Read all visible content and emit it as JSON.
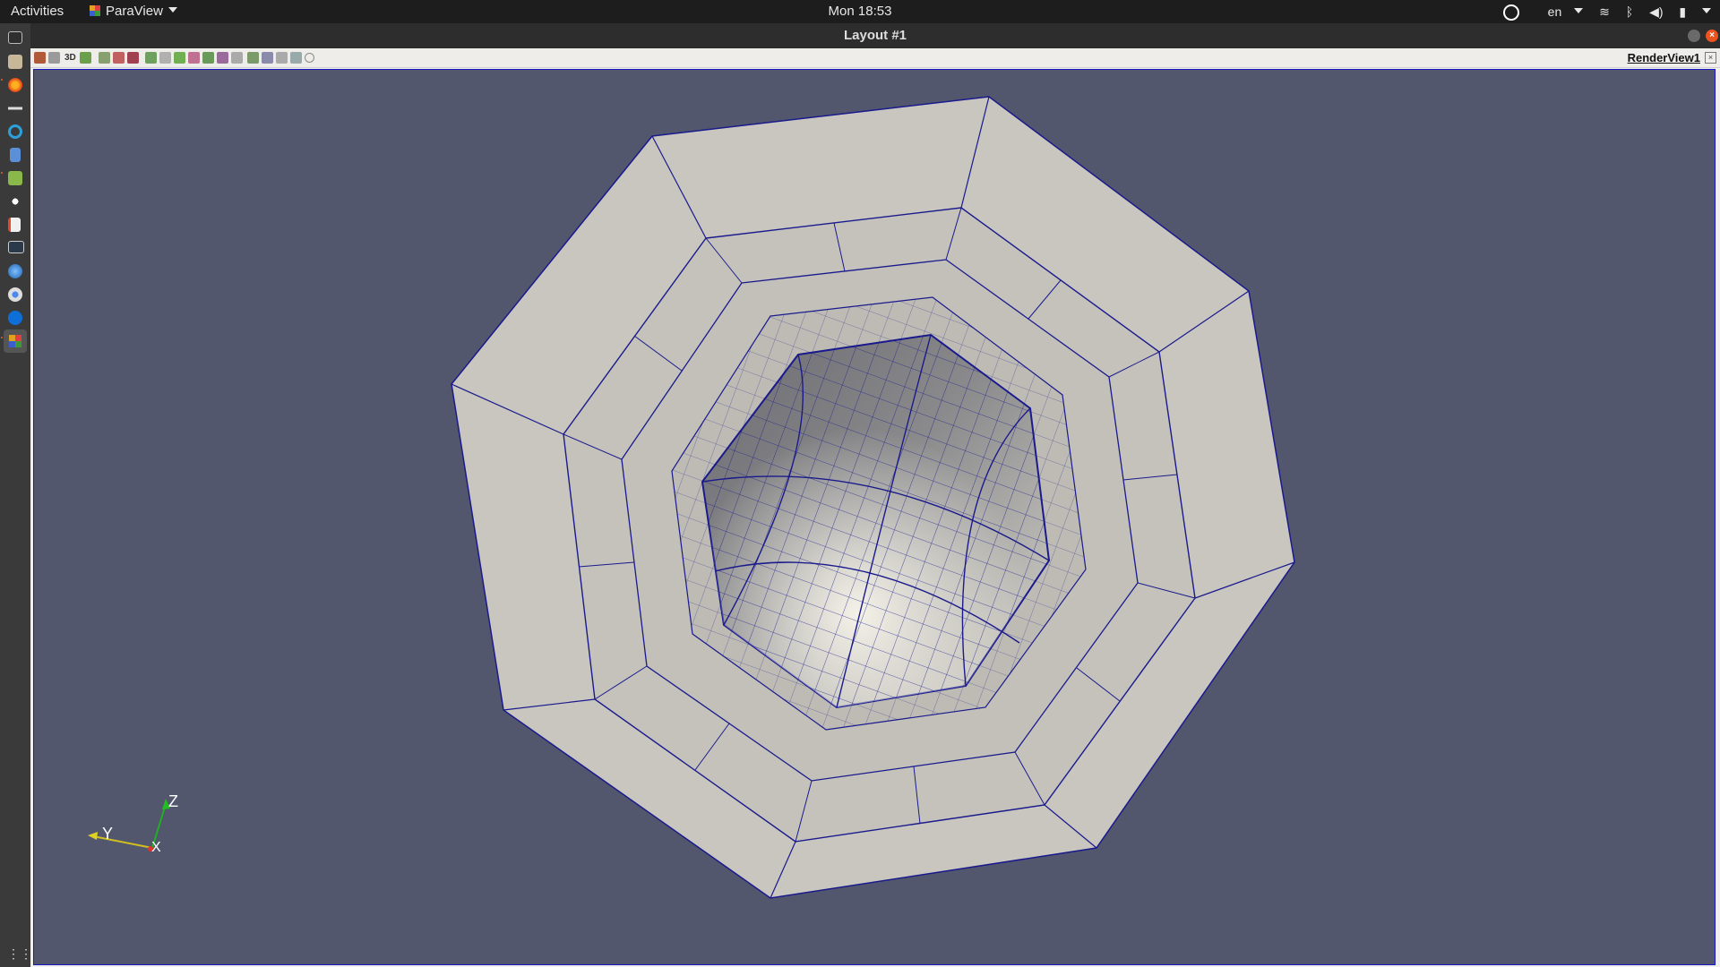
{
  "topbar": {
    "activities": "Activities",
    "app_name": "ParaView",
    "clock": "Mon 18:53",
    "language": "en"
  },
  "dock": {
    "items": [
      "terminal-icon",
      "files-icon",
      "firefox-icon",
      "dash-icon",
      "sync-icon",
      "document-icon",
      "package-icon",
      "eye-icon",
      "editor-icon",
      "monitor-icon",
      "globe-icon",
      "chrome-icon",
      "teamviewer-icon",
      "paraview-icon"
    ]
  },
  "window": {
    "title": "Layout #1",
    "view_tab": "RenderView1",
    "toolbar_3d": "3D"
  },
  "orientation_axes": {
    "z_label": "Z",
    "y_label": "Y",
    "x_label": "X"
  },
  "colors": {
    "background": "#52576e",
    "mesh_edges": "#1a1a8c",
    "surface": "#c8c6bf"
  }
}
